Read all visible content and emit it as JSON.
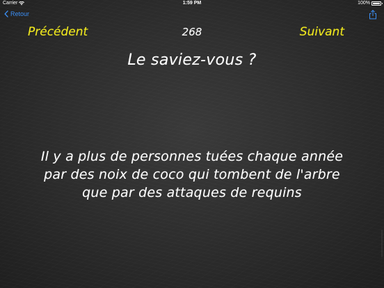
{
  "status_bar": {
    "carrier": "Carrier",
    "time": "1:59 PM",
    "battery_percent": "100%",
    "battery_level": 1.0
  },
  "nav": {
    "back_label": "Retour",
    "share_icon": "share-icon",
    "accent_color": "#3b8ff5"
  },
  "pager": {
    "prev_label": "Précédent",
    "counter": "268",
    "next_label": "Suivant",
    "accent_color": "#f0e81e"
  },
  "content": {
    "title": "Le saviez-vous ?",
    "fact_lines": [
      "Il y a plus de personnes tuées chaque année",
      "par des noix de coco qui tombent de l'arbre",
      "que par des attaques de requins"
    ]
  }
}
